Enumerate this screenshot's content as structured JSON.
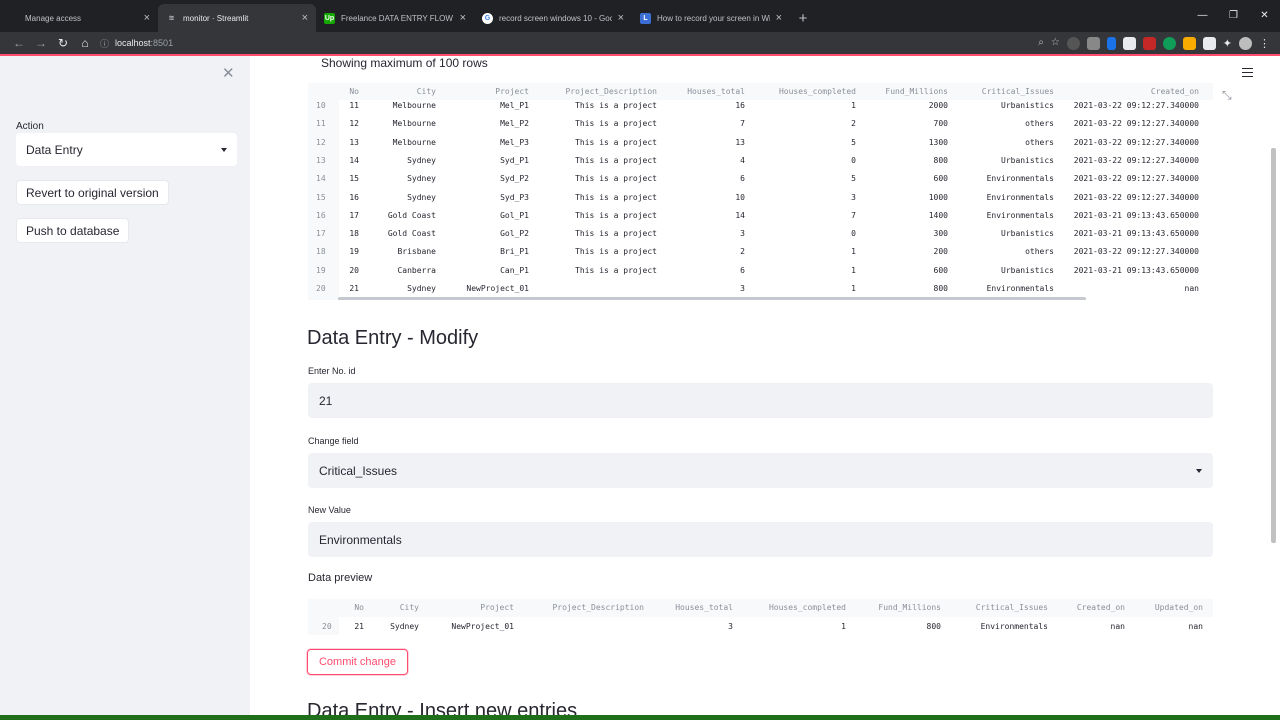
{
  "browser": {
    "tabs": [
      {
        "title": "Manage access",
        "active": false,
        "favicon": "none"
      },
      {
        "title": "monitor · Streamlit",
        "active": true,
        "favicon": "streamlit"
      },
      {
        "title": "Freelance DATA ENTRY FLOW CH",
        "active": false,
        "favicon": "upwork"
      },
      {
        "title": "record screen windows 10 - Goo",
        "active": false,
        "favicon": "google"
      },
      {
        "title": "How to record your screen in Wi",
        "active": false,
        "favicon": "blue-l"
      }
    ],
    "new_tab_label": "+",
    "url_host": "localhost",
    "url_port": ":8501"
  },
  "sidebar": {
    "action_label": "Action",
    "action_value": "Data Entry",
    "revert_label": "Revert to original version",
    "push_label": "Push to database"
  },
  "main": {
    "rows_note": "Showing maximum of 100 rows",
    "table": {
      "headers": [
        "No",
        "City",
        "Project",
        "Project_Description",
        "Houses_total",
        "Houses_completed",
        "Fund_Millions",
        "Critical_Issues",
        "Created_on"
      ],
      "rows": [
        [
          "10",
          "11",
          "Melbourne",
          "Mel_P1",
          "This is a project",
          "16",
          "1",
          "2000",
          "Urbanistics",
          "2021-03-22 09:12:27.340000"
        ],
        [
          "11",
          "12",
          "Melbourne",
          "Mel_P2",
          "This is a project",
          "7",
          "2",
          "700",
          "others",
          "2021-03-22 09:12:27.340000"
        ],
        [
          "12",
          "13",
          "Melbourne",
          "Mel_P3",
          "This is a project",
          "13",
          "5",
          "1300",
          "others",
          "2021-03-22 09:12:27.340000"
        ],
        [
          "13",
          "14",
          "Sydney",
          "Syd_P1",
          "This is a project",
          "4",
          "0",
          "800",
          "Urbanistics",
          "2021-03-22 09:12:27.340000"
        ],
        [
          "14",
          "15",
          "Sydney",
          "Syd_P2",
          "This is a project",
          "6",
          "5",
          "600",
          "Environmentals",
          "2021-03-22 09:12:27.340000"
        ],
        [
          "15",
          "16",
          "Sydney",
          "Syd_P3",
          "This is a project",
          "10",
          "3",
          "1000",
          "Environmentals",
          "2021-03-22 09:12:27.340000"
        ],
        [
          "16",
          "17",
          "Gold Coast",
          "Gol_P1",
          "This is a project",
          "14",
          "7",
          "1400",
          "Environmentals",
          "2021-03-21 09:13:43.650000"
        ],
        [
          "17",
          "18",
          "Gold Coast",
          "Gol_P2",
          "This is a project",
          "3",
          "0",
          "300",
          "Urbanistics",
          "2021-03-21 09:13:43.650000"
        ],
        [
          "18",
          "19",
          "Brisbane",
          "Bri_P1",
          "This is a project",
          "2",
          "1",
          "200",
          "others",
          "2021-03-22 09:12:27.340000"
        ],
        [
          "19",
          "20",
          "Canberra",
          "Can_P1",
          "This is a project",
          "6",
          "1",
          "600",
          "Urbanistics",
          "2021-03-21 09:13:43.650000"
        ],
        [
          "20",
          "21",
          "Sydney",
          "NewProject_01",
          "",
          "3",
          "1",
          "800",
          "Environmentals",
          "nan"
        ]
      ]
    },
    "modify_title": "Data Entry - Modify",
    "id_label": "Enter No. id",
    "id_value": "21",
    "field_label": "Change field",
    "field_value": "Critical_Issues",
    "new_value_label": "New Value",
    "new_value": "Environmentals",
    "preview_label": "Data preview",
    "preview": {
      "headers": [
        "No",
        "City",
        "Project",
        "Project_Description",
        "Houses_total",
        "Houses_completed",
        "Fund_Millions",
        "Critical_Issues",
        "Created_on",
        "Updated_on"
      ],
      "row": [
        "20",
        "21",
        "Sydney",
        "NewProject_01",
        "",
        "3",
        "1",
        "800",
        "Environmentals",
        "nan",
        "nan"
      ]
    },
    "commit_label": "Commit change",
    "insert_title": "Data Entry - Insert new entries"
  },
  "colors": {
    "accent": "#ff4b6e",
    "sidebar_bg": "#f0f2f6",
    "text": "#262730"
  }
}
